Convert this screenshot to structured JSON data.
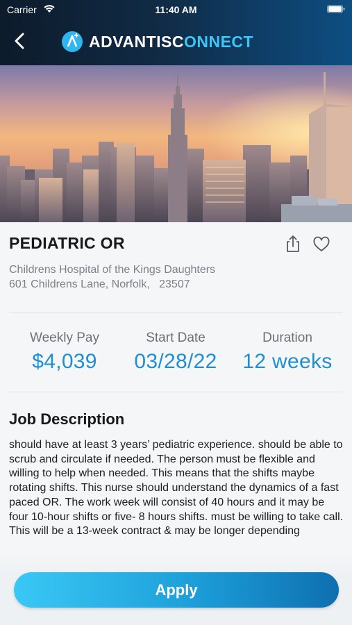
{
  "status_bar": {
    "carrier": "Carrier",
    "time": "11:40 AM"
  },
  "nav": {
    "back_icon": "chevron-left-icon",
    "logo_text_primary": "ADVANTISC",
    "logo_text_accent": "NNECT",
    "logo_text_o": "O"
  },
  "job": {
    "title": "PEDIATRIC OR",
    "facility_name": "Childrens Hospital of the Kings Daughters",
    "facility_address": "601 Childrens Lane, Norfolk,   23507",
    "actions": {
      "share_icon": "share-icon",
      "favorite_icon": "heart-icon"
    }
  },
  "stats": [
    {
      "label": "Weekly Pay",
      "value": "$4,039"
    },
    {
      "label": "Start Date",
      "value": "03/28/22"
    },
    {
      "label": "Duration",
      "value": "12 weeks"
    }
  ],
  "description": {
    "heading": "Job Description",
    "body": "should have at least 3 years’ pediatric experience.  should be able to scrub and circulate if needed. The person must be flexible and willing to help when needed. This means that the shifts maybe rotating shifts. This nurse should understand the dynamics of a fast paced OR. The work week will consist of 40 hours and it may be four 10-hour shifts or five- 8 hours shifts. must be willing to take call. This will be a 13-week contract & may be longer depending"
  },
  "footer": {
    "apply_label": "Apply"
  },
  "colors": {
    "accent": "#1e8fd0",
    "header_dark": "#0d1b2b",
    "logo_accent": "#3fc4f4"
  }
}
